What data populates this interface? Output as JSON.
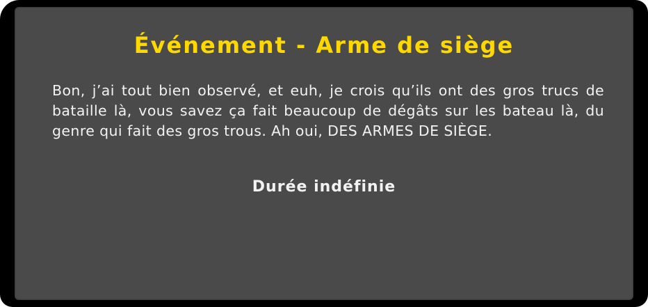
{
  "event": {
    "title": "Événement - Arme de siège",
    "description": "Bon, j’ai tout bien observé, et euh, je crois qu’ils ont des gros trucs de bataille là, vous savez ça fait beaucoup de dégâts sur les bateau là, du genre qui fait des gros trous. Ah oui, DES ARMES DE SIÈGE.",
    "duration": "Durée indéfinie"
  },
  "colors": {
    "title": "#ffd800",
    "panel": "#4a4a4a",
    "frame": "#000000",
    "text": "#f2f2f2"
  }
}
